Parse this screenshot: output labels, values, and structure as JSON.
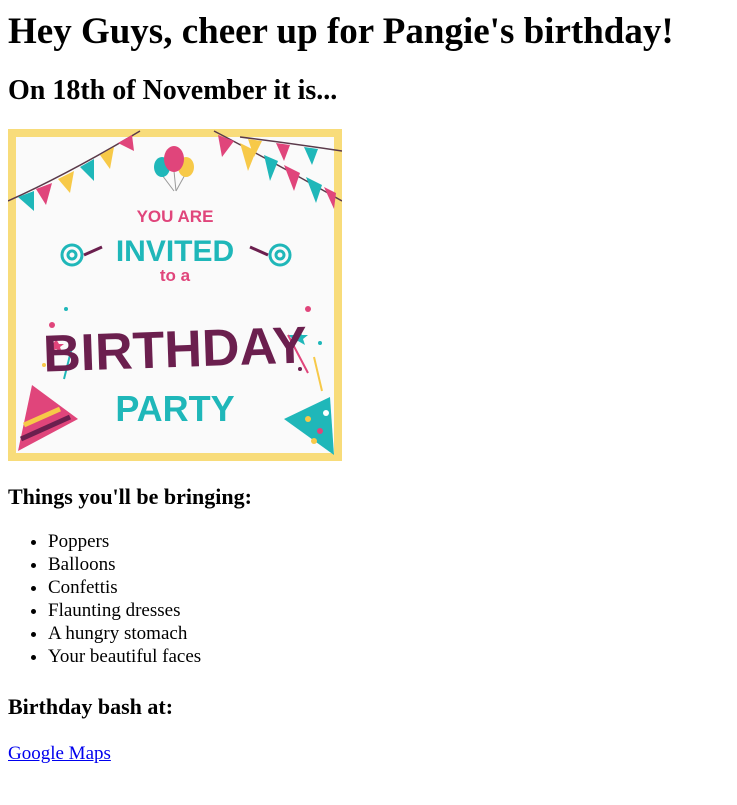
{
  "page": {
    "title": "Hey Guys, cheer up for Pangie's birthday!",
    "subtitle": "On 18th of November it is..."
  },
  "invitation": {
    "line1": "YOU ARE",
    "line2": "INVITED",
    "line3": "to a",
    "line4": "BIRTHDAY",
    "line5": "PARTY",
    "colors": {
      "border": "#f8dc7a",
      "pink": "#e0457b",
      "teal": "#1fb7b9",
      "plum": "#6b1f4e",
      "yellow": "#f7c948"
    }
  },
  "bring": {
    "heading": "Things you'll be bringing:",
    "items": [
      "Poppers",
      "Balloons",
      "Confettis",
      "Flaunting dresses",
      "A hungry stomach",
      "Your beautiful faces"
    ]
  },
  "venue": {
    "heading": "Birthday bash at:",
    "link_label": "Google Maps"
  }
}
